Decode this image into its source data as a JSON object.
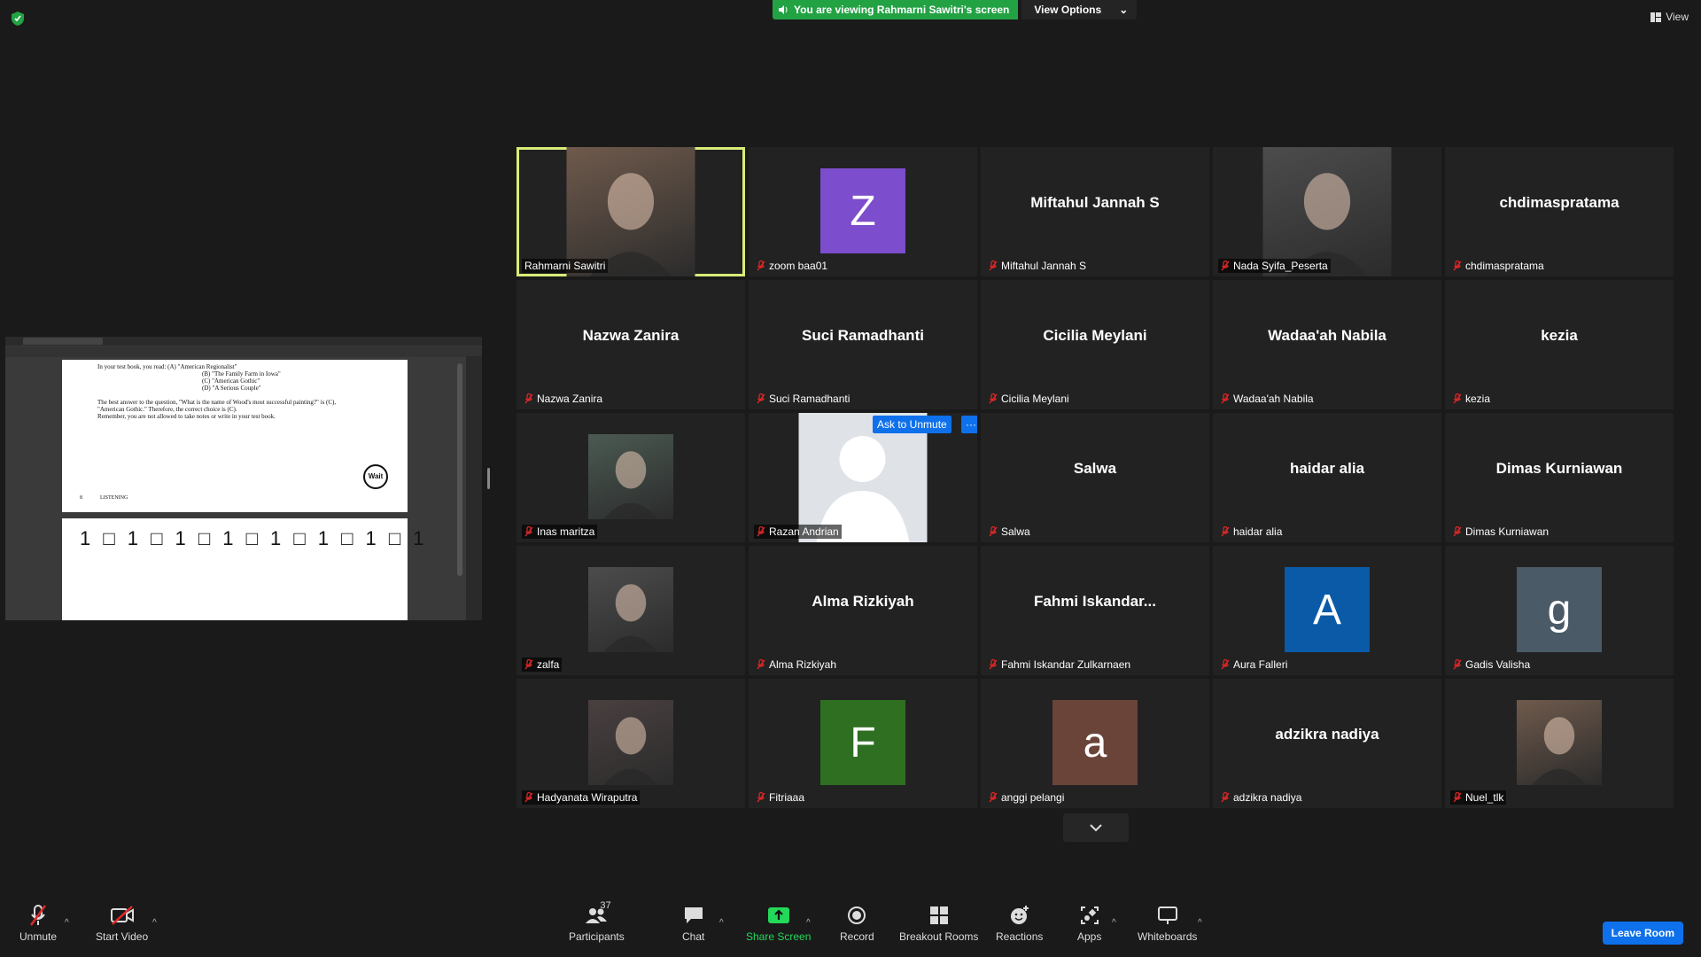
{
  "top": {
    "banner_text": "You are viewing Rahmarni Sawitri's screen",
    "view_options": "View Options",
    "view": "View"
  },
  "shared_screen": {
    "doc_lines": [
      "In your test book, you read:   (A)  \"American Regionalist\"",
      "(B)  \"The Family Farm in Iowa\"",
      "(C)  \"American Gothic\"",
      "(D)  \"A Serious Couple\"",
      "The best answer to the question, \"What is the name of Wood's most successful painting?\" is (C),",
      "\"American Gothic.\" Therefore, the correct choice is (C).",
      "Remember, you are not allowed to take notes or write in your test book."
    ],
    "wait_label": "Wait",
    "page_num": "8",
    "section": "LISTENING",
    "digits": "1 □ 1 □ 1 □ 1 □ 1 □ 1 □ 1 □ 1"
  },
  "participants": [
    {
      "label": "Rahmarni Sawitri",
      "display": "",
      "kind": "photo",
      "speaking": true,
      "muted": false
    },
    {
      "label": "zoom baa01",
      "display": "",
      "kind": "letter",
      "letter": "Z",
      "color": "#7c4dcc",
      "muted": true
    },
    {
      "label": "Miftahul Jannah S",
      "display": "Miftahul Jannah S",
      "kind": "name",
      "muted": true
    },
    {
      "label": "Nada Syifa_Peserta",
      "display": "",
      "kind": "photo",
      "muted": true
    },
    {
      "label": "chdimaspratama",
      "display": "chdimaspratama",
      "kind": "name",
      "muted": true
    },
    {
      "label": "Nazwa Zanira",
      "display": "Nazwa Zanira",
      "kind": "name",
      "muted": true
    },
    {
      "label": "Suci Ramadhanti",
      "display": "Suci Ramadhanti",
      "kind": "name",
      "muted": true
    },
    {
      "label": "Cicilia Meylani",
      "display": "Cicilia Meylani",
      "kind": "name",
      "muted": true
    },
    {
      "label": "Wadaa'ah Nabila",
      "display": "Wadaa'ah Nabila",
      "kind": "name",
      "muted": true
    },
    {
      "label": "kezia",
      "display": "kezia",
      "kind": "name",
      "muted": true
    },
    {
      "label": "Inas maritza",
      "display": "",
      "kind": "photo",
      "muted": true
    },
    {
      "label": "Razan Andrian",
      "display": "",
      "kind": "silhouette",
      "muted": true,
      "ask_unmute": "Ask to Unmute",
      "more": "···"
    },
    {
      "label": "Salwa",
      "display": "Salwa",
      "kind": "name",
      "muted": true
    },
    {
      "label": "haidar alia",
      "display": "haidar alia",
      "kind": "name",
      "muted": true
    },
    {
      "label": "Dimas Kurniawan",
      "display": "Dimas Kurniawan",
      "kind": "name",
      "muted": true
    },
    {
      "label": "zalfa",
      "display": "",
      "kind": "photo",
      "muted": true
    },
    {
      "label": "Alma Rizkiyah",
      "display": "Alma Rizkiyah",
      "kind": "name",
      "muted": true
    },
    {
      "label": "Fahmi Iskandar Zulkarnaen",
      "display": "Fahmi  Iskandar...",
      "kind": "name",
      "muted": true
    },
    {
      "label": "Aura Falleri",
      "display": "",
      "kind": "letter",
      "letter": "A",
      "color": "#0a5aa8",
      "muted": true
    },
    {
      "label": "Gadis Valisha",
      "display": "",
      "kind": "letter",
      "letter": "g",
      "color": "#4a5a66",
      "muted": true
    },
    {
      "label": "Hadyanata Wiraputra",
      "display": "",
      "kind": "photo",
      "muted": true
    },
    {
      "label": "Fitriaaa",
      "display": "",
      "kind": "letter",
      "letter": "F",
      "color": "#2e6f22",
      "muted": true
    },
    {
      "label": "anggi pelangi",
      "display": "",
      "kind": "letter",
      "letter": "a",
      "color": "#6b4439",
      "muted": true
    },
    {
      "label": "adzikra nadiya",
      "display": "adzikra nadiya",
      "kind": "name",
      "muted": true
    },
    {
      "label": "Nuel_tlk",
      "display": "",
      "kind": "photo",
      "muted": true
    }
  ],
  "toolbar": {
    "unmute": "Unmute",
    "start_video": "Start Video",
    "participants": "Participants",
    "participants_count": "37",
    "chat": "Chat",
    "share_screen": "Share Screen",
    "record": "Record",
    "breakout_rooms": "Breakout Rooms",
    "reactions": "Reactions",
    "apps": "Apps",
    "whiteboards": "Whiteboards",
    "leave_room": "Leave Room"
  },
  "colors": {
    "share_green": "#23a244",
    "accent_blue": "#0e71eb",
    "speaking_outline": "#d9ec78",
    "muted_red": "#e02828"
  }
}
